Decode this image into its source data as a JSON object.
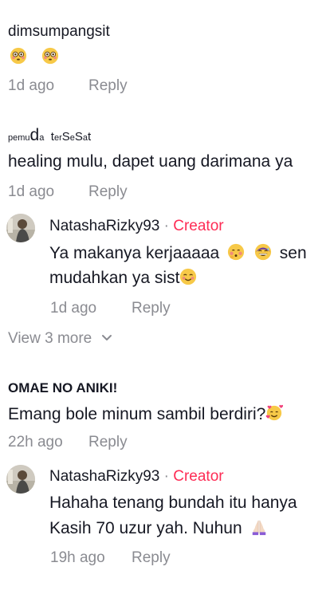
{
  "comments": [
    {
      "username": "dimsumpangsit",
      "text": "",
      "emojis": [
        "flushed-face-icon",
        "flushed-face-icon"
      ],
      "time": "1d ago",
      "reply_label": "Reply"
    },
    {
      "username": "pemudatersesat",
      "username_parts": [
        "pemu",
        "d",
        "a",
        "t",
        "er",
        "S",
        "e",
        "S",
        "a",
        "t"
      ],
      "text": "healing mulu, dapet uang darimana ya",
      "time": "1d ago",
      "reply_label": "Reply",
      "replies": [
        {
          "username": "NatashaRizky93",
          "separator": "·",
          "badge": "Creator",
          "line1": "Ya makanya kerjaaaaa",
          "line1_emojis": [
            "shy-face-icon",
            "sweat-smile-icon"
          ],
          "line1_tail": "sen",
          "line2": "mudahkan ya sist",
          "line2_emoji": "blush-smile-icon",
          "time": "1d ago",
          "reply_label": "Reply"
        }
      ],
      "view_more": "View 3 more"
    },
    {
      "username": "OMAE NO ANIKI!",
      "text": "Emang bole minum sambil berdiri?",
      "text_emoji": "hearts-face-icon",
      "time": "22h ago",
      "reply_label": "Reply",
      "replies": [
        {
          "username": "NatashaRizky93",
          "separator": "·",
          "badge": "Creator",
          "line1": "Hahaha tenang bundah itu hanya",
          "line2": "Kasih 70 uzur yah. Nuhun",
          "line2_emoji": "pray-hands-icon",
          "time": "19h ago",
          "reply_label": "Reply"
        }
      ]
    }
  ]
}
